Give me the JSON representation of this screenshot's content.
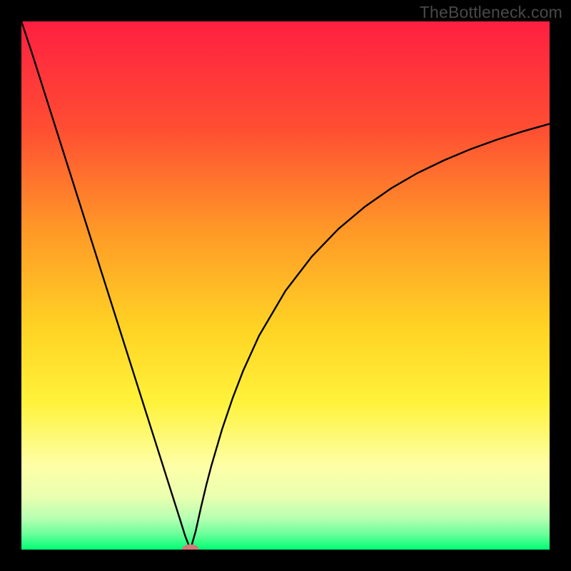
{
  "watermark": "TheBottleneck.com",
  "chart_data": {
    "type": "line",
    "title": "",
    "xlabel": "",
    "ylabel": "",
    "xlim": [
      0,
      100
    ],
    "ylim": [
      0,
      100
    ],
    "background_gradient": [
      "#ff1f41",
      "#ff6e2a",
      "#ffc722",
      "#fff33a",
      "#fdffb3",
      "#a8ffb3",
      "#00ff74"
    ],
    "x": [
      0,
      2,
      4,
      6,
      8,
      10,
      12,
      14,
      16,
      18,
      20,
      22,
      24,
      26,
      28,
      30,
      31,
      32,
      33,
      34,
      35,
      36,
      38,
      40,
      42,
      45,
      50,
      55,
      60,
      65,
      70,
      75,
      80,
      85,
      90,
      95,
      100
    ],
    "values": [
      100,
      94,
      87.7,
      81.4,
      75.1,
      68.8,
      62.5,
      56.2,
      49.9,
      43.6,
      37.3,
      31,
      24.7,
      18.4,
      12.1,
      5.8,
      2.6,
      0,
      3.5,
      8,
      12.2,
      16,
      22.8,
      28.7,
      33.9,
      40.5,
      49,
      55.5,
      60.7,
      64.9,
      68.4,
      71.3,
      73.7,
      75.8,
      77.6,
      79.2,
      80.6
    ],
    "marker": {
      "x": 32,
      "y": 0,
      "rx": 1.6,
      "ry": 1.0,
      "color": "#cf7a78"
    }
  }
}
